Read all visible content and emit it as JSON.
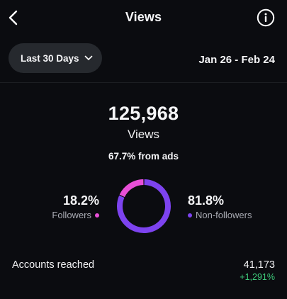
{
  "header": {
    "title": "Views",
    "back_icon": "chevron-left-icon",
    "info_icon": "info-circle-icon"
  },
  "filter": {
    "range_label": "Last 30 Days",
    "dropdown_icon": "chevron-down-icon",
    "date_range": "Jan 26 - Feb 24"
  },
  "summary": {
    "total_views": "125,968",
    "total_label": "Views",
    "ads_text": "67.7% from ads"
  },
  "breakdown": {
    "followers": {
      "percent": "18.2%",
      "label": "Followers",
      "value": 18.2,
      "color": "#e84fd7"
    },
    "non_followers": {
      "percent": "81.8%",
      "label": "Non-followers",
      "value": 81.8,
      "color": "#7d43ef"
    }
  },
  "reach": {
    "label": "Accounts reached",
    "value": "41,173",
    "change": "+1,291%",
    "change_color": "#3ec97a"
  }
}
